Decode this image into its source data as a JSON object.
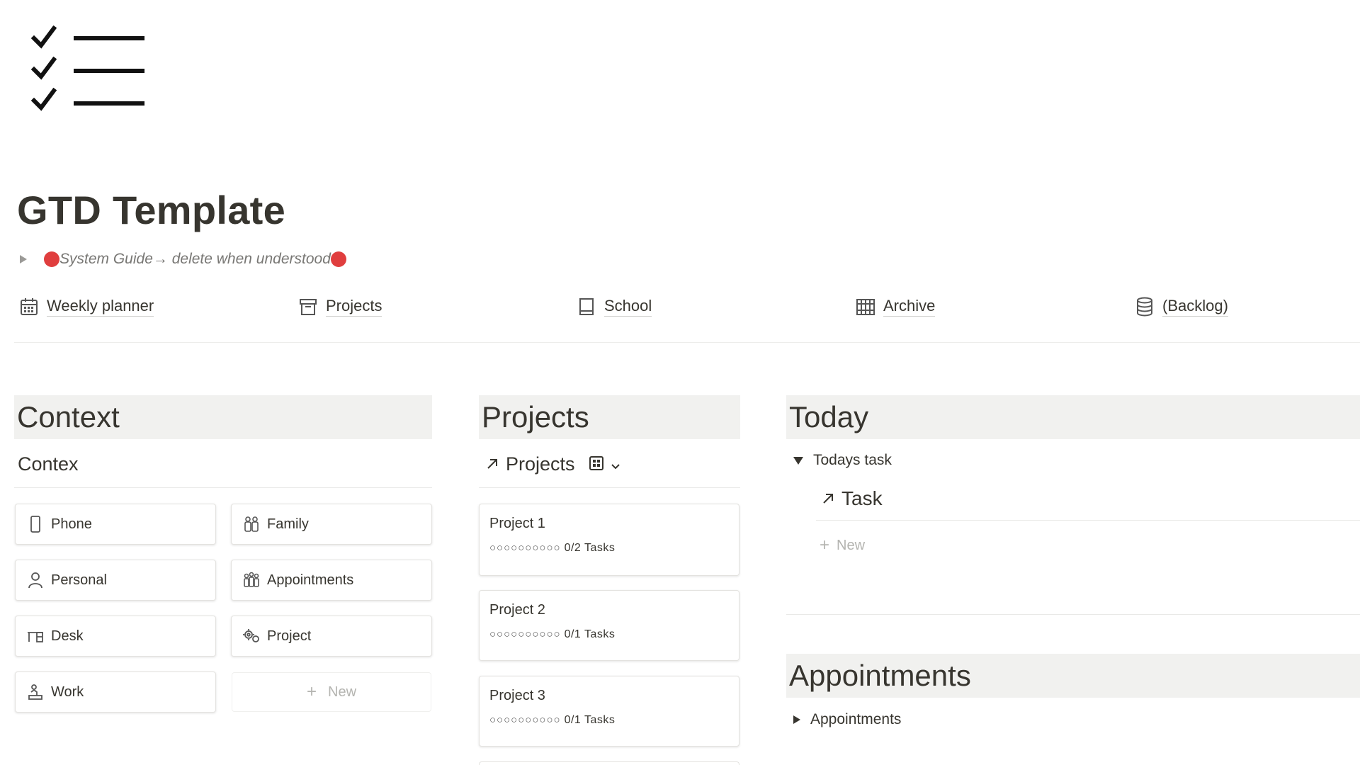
{
  "page": {
    "icon": "checklist-icon",
    "title": "GTD Template",
    "guide_toggle": "System Guide→ delete when understood"
  },
  "links": [
    {
      "label": "Weekly planner",
      "icon": "calendar-icon"
    },
    {
      "label": "Projects",
      "icon": "archive-box-icon"
    },
    {
      "label": "School",
      "icon": "notebook-icon"
    },
    {
      "label": "Archive",
      "icon": "books-icon"
    },
    {
      "label": "(Backlog)",
      "icon": "database-icon"
    }
  ],
  "context": {
    "header": "Context",
    "db_title": "Contex",
    "cards": [
      {
        "label": "Phone",
        "icon": "phone-icon"
      },
      {
        "label": "Family",
        "icon": "family-icon"
      },
      {
        "label": "Personal",
        "icon": "person-icon"
      },
      {
        "label": "Appointments",
        "icon": "group-icon"
      },
      {
        "label": "Desk",
        "icon": "desk-icon"
      },
      {
        "label": "Project",
        "icon": "gears-icon"
      },
      {
        "label": "Work",
        "icon": "worker-icon"
      }
    ],
    "new_label": "New"
  },
  "projects": {
    "header": "Projects",
    "db_title": "Projects",
    "items": [
      {
        "name": "Project 1",
        "dots": "○○○○○○○○○○",
        "progress": "0/2 Tasks"
      },
      {
        "name": "Project 2",
        "dots": "○○○○○○○○○○",
        "progress": "0/1 Tasks"
      },
      {
        "name": "Project 3",
        "dots": "○○○○○○○○○○",
        "progress": "0/1 Tasks"
      }
    ]
  },
  "today": {
    "header": "Today",
    "toggle": "Todays task",
    "db_title": "Task",
    "new_label": "New"
  },
  "appointments": {
    "header": "Appointments",
    "toggle": "Appointments"
  },
  "colors": {
    "text": "#37352f",
    "muted": "#787774",
    "header_bg": "#f1f1ef",
    "red_dot": "#e03e3e"
  }
}
